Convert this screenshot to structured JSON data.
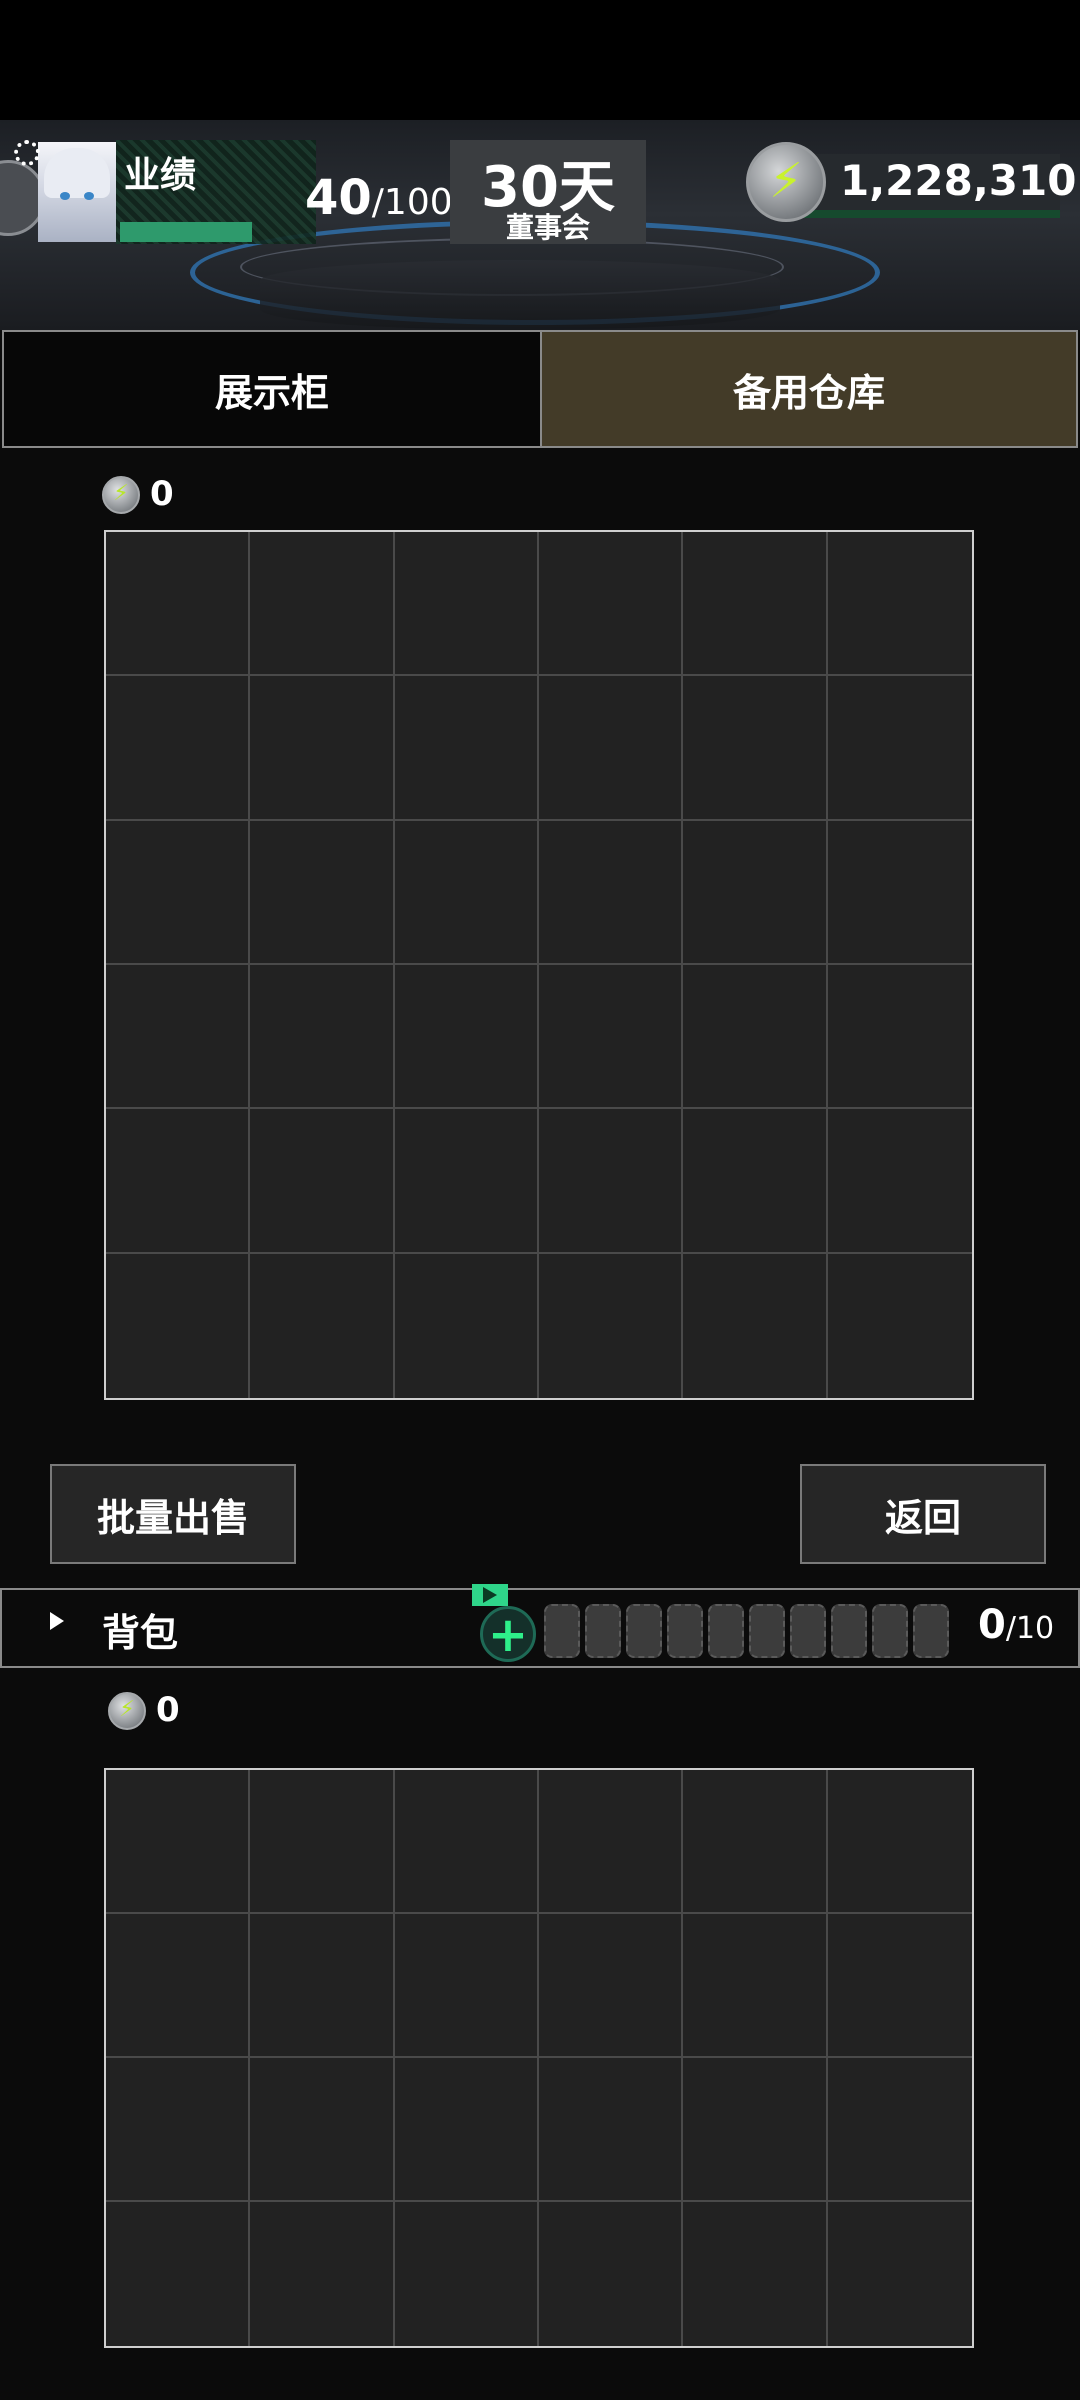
{
  "header": {
    "performance_label": "业绩",
    "performance_current": "40",
    "performance_max": "/100",
    "performance_fraction": 0.4,
    "days_value": "30天",
    "days_sub": "董事会",
    "currency_value": "1,228,310"
  },
  "tabs": [
    {
      "label": "展示柜",
      "active": false
    },
    {
      "label": "备用仓库",
      "active": true
    }
  ],
  "showcase": {
    "coin_count": "0",
    "rows": 6,
    "cols": 6
  },
  "actions": {
    "bulk_sell_label": "批量出售",
    "back_label": "返回"
  },
  "backpack": {
    "label": "背包",
    "capacity_current": "0",
    "capacity_max": "/10",
    "locked_slots": 10,
    "coin_count": "0",
    "rows": 4,
    "cols": 6
  },
  "colors": {
    "active_tab": "#433b28",
    "accent_green": "#2ef08a",
    "progress_green": "#2e9a6c",
    "bolt_yellow": "#c9f22d"
  }
}
